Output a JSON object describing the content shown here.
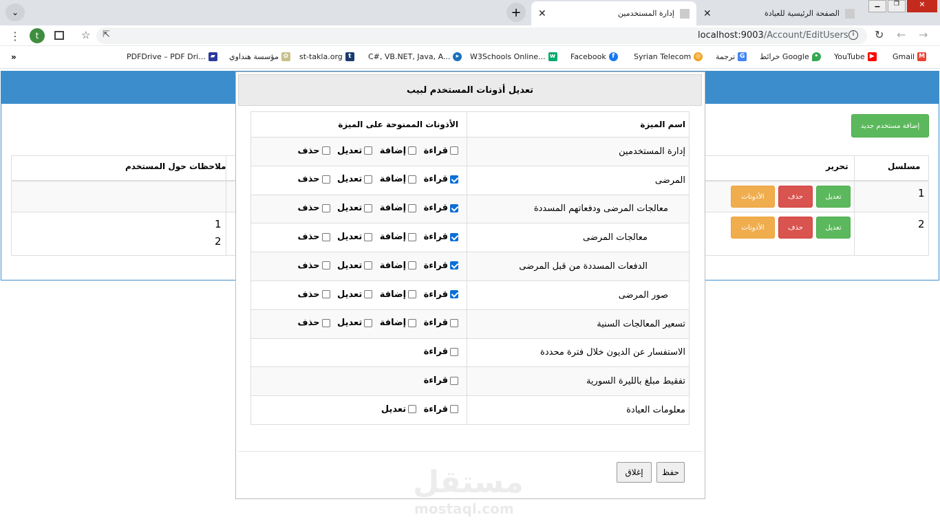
{
  "browser": {
    "tabs": [
      {
        "title": "الصفحة الرئيسية للعيادة"
      },
      {
        "title": "إدارة المستخدمين"
      }
    ],
    "url_host": "localhost:9003",
    "url_path": "/Account/EditUsers",
    "profile_initial": "t",
    "bookmarks": [
      "Gmail",
      "YouTube",
      "خرائط Google",
      "ترجمة",
      "Syrian Telecom",
      "Facebook",
      "W3Schools Online...",
      "C#, VB.NET, Java, A...",
      "st-takla.org",
      "مؤسسة هنداوي",
      "PDFDrive – PDF Dri..."
    ],
    "more": "»"
  },
  "page": {
    "add_user_button": "إضافة مستخدم جديد",
    "columns": {
      "serial": "مسلسل",
      "edit": "تحرير",
      "notes": "ملاحظات حول المستخدم"
    },
    "rows": [
      {
        "serial": "1",
        "notes": ""
      },
      {
        "serial": "2",
        "notes_lines": [
          "1",
          "2"
        ]
      }
    ],
    "row_buttons": {
      "edit": "تعديل",
      "delete": "حذف",
      "permissions": "الأذونات"
    }
  },
  "modal": {
    "title": "تعديل أذونات المستخدم لبيب",
    "col_feature": "اسم الميزة",
    "col_perms": "الأذونات الممنوحة على الميزة",
    "labels": {
      "read": "قراءة",
      "add": "إضافة",
      "edit": "تعديل",
      "delete": "حذف"
    },
    "features": [
      {
        "name": "إدارة المستخدمين"
      },
      {
        "name": "المرضى"
      },
      {
        "name": "معالجات المرضى ودفعاتهم المسددة"
      },
      {
        "name": "معالجات المرضى"
      },
      {
        "name": "الدفعات المسددة من قبل المرضى"
      },
      {
        "name": "صور المرضى"
      },
      {
        "name": "تسعير المعالجات السنية"
      },
      {
        "name": "الاستفسار عن الديون خلال فترة محددة"
      },
      {
        "name": "تفقيط مبلغ بالليرة السورية"
      },
      {
        "name": "معلومات العيادة"
      }
    ],
    "save": "حفظ",
    "close": "إغلاق"
  },
  "watermark": {
    "arabic": "مستقل",
    "latin": "mostaql.com"
  }
}
